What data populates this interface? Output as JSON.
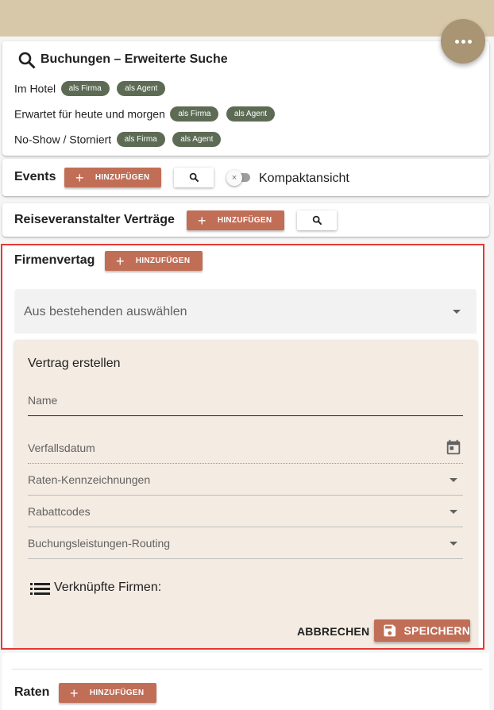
{
  "search_card": {
    "title": "Buchungen – Erweiterte Suche",
    "rows": [
      {
        "label": "Im Hotel",
        "chip1": "als Firma",
        "chip2": "als Agent"
      },
      {
        "label": "Erwartet für heute und morgen",
        "chip1": "als Firma",
        "chip2": "als Agent"
      },
      {
        "label": "No-Show / Storniert",
        "chip1": "als Firma",
        "chip2": "als Agent"
      }
    ]
  },
  "events": {
    "title": "Events",
    "add_label": "HINZUFÜGEN",
    "toggle_label": "Kompaktansicht",
    "toggle_on": false
  },
  "tour_operator": {
    "title": "Reiseveranstalter Verträge",
    "add_label": "HINZUFÜGEN"
  },
  "company_contract": {
    "title": "Firmenvertag",
    "add_label": "HINZUFÜGEN",
    "select_placeholder": "Aus bestehenden auswählen",
    "form": {
      "title": "Vertrag erstellen",
      "name_label": "Name",
      "expiry_label": "Verfallsdatum",
      "rate_codes_label": "Raten-Kennzeichnungen",
      "discount_label": "Rabattcodes",
      "routing_label": "Buchungsleistungen-Routing",
      "linked_companies_label": "Verknüpfte Firmen:",
      "cancel_label": "ABBRECHEN",
      "save_label": "SPEICHERN"
    }
  },
  "rates": {
    "title": "Raten",
    "add_label": "HINZUFÜGEN"
  },
  "colors": {
    "accent": "#c16e57",
    "chip": "#5d6b54",
    "topbar": "#d8c8aa",
    "fab": "#a99474",
    "form_bg": "#f4ebe2",
    "highlight": "#e53935"
  }
}
